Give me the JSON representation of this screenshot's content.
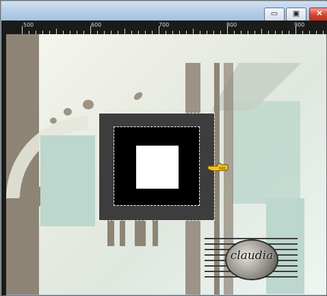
{
  "window": {
    "controls": {
      "minimize": "▭",
      "maximize": "▣",
      "close": "✕"
    },
    "accent": "#b3cbe6"
  },
  "ruler": {
    "labels": [
      "500",
      "600",
      "700",
      "800",
      "900"
    ]
  },
  "canvas": {
    "selection_color": "#3d3d3d",
    "inner_color": "#000000",
    "core_color": "#ffffff"
  },
  "watermark": {
    "text": "claudia"
  },
  "icons": {
    "cursor": "pointing-hand-icon"
  }
}
